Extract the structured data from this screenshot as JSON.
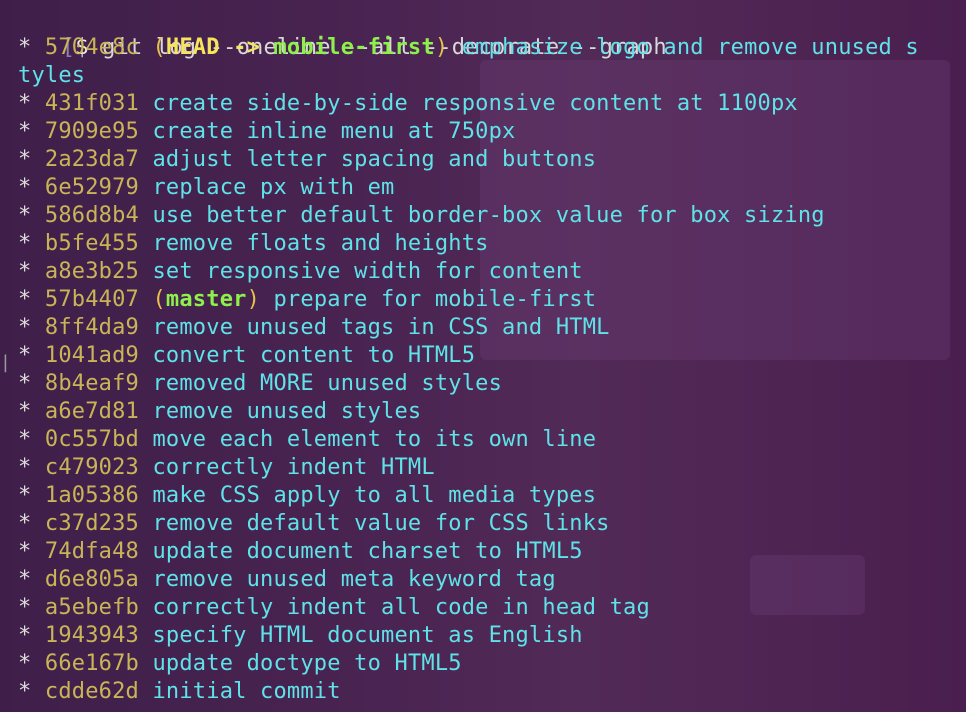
{
  "prompt": {
    "open_bracket": "[",
    "symbol": "$",
    "command": " git log --oneline --all --decorate --graph",
    "close_bracket": "]"
  },
  "commits": [
    {
      "graph": "* ",
      "hash": "5704e8c",
      "ref_open": "(",
      "head": "HEAD -> ",
      "branch": "mobile-first",
      "ref_close": ")",
      "message": "emphasize logo and remove unused s"
    },
    {
      "graph": "",
      "hash": "",
      "message": "tyles"
    },
    {
      "graph": "* ",
      "hash": "431f031",
      "message": "create side-by-side responsive content at 1100px"
    },
    {
      "graph": "* ",
      "hash": "7909e95",
      "message": "create inline menu at 750px"
    },
    {
      "graph": "* ",
      "hash": "2a23da7",
      "message": "adjust letter spacing and buttons"
    },
    {
      "graph": "* ",
      "hash": "6e52979",
      "message": "replace px with em"
    },
    {
      "graph": "* ",
      "hash": "586d8b4",
      "message": "use better default border-box value for box sizing"
    },
    {
      "graph": "* ",
      "hash": "b5fe455",
      "message": "remove floats and heights"
    },
    {
      "graph": "* ",
      "hash": "a8e3b25",
      "message": "set responsive width for content"
    },
    {
      "graph": "* ",
      "hash": "57b4407",
      "ref_open": "(",
      "branch": "master",
      "ref_close": ")",
      "message": "prepare for mobile-first"
    },
    {
      "graph": "* ",
      "hash": "8ff4da9",
      "message": "remove unused tags in CSS and HTML"
    },
    {
      "graph": "* ",
      "hash": "1041ad9",
      "message": "convert content to HTML5"
    },
    {
      "graph": "* ",
      "hash": "8b4eaf9",
      "message": "removed MORE unused styles"
    },
    {
      "graph": "* ",
      "hash": "a6e7d81",
      "message": "remove unused styles"
    },
    {
      "graph": "* ",
      "hash": "0c557bd",
      "message": "move each element to its own line"
    },
    {
      "graph": "* ",
      "hash": "c479023",
      "message": "correctly indent HTML"
    },
    {
      "graph": "* ",
      "hash": "1a05386",
      "message": "make CSS apply to all media types"
    },
    {
      "graph": "* ",
      "hash": "c37d235",
      "message": "remove default value for CSS links"
    },
    {
      "graph": "* ",
      "hash": "74dfa48",
      "message": "update document charset to HTML5"
    },
    {
      "graph": "* ",
      "hash": "d6e805a",
      "message": "remove unused meta keyword tag"
    },
    {
      "graph": "* ",
      "hash": "a5ebefb",
      "message": "correctly indent all code in head tag"
    },
    {
      "graph": "* ",
      "hash": "1943943",
      "message": "specify HTML document as English"
    },
    {
      "graph": "* ",
      "hash": "66e167b",
      "message": "update doctype to HTML5"
    },
    {
      "graph": "* ",
      "hash": "cdde62d",
      "message": "initial commit"
    }
  ],
  "colors": {
    "message": "#5fe2e8",
    "hash": "#c9b457",
    "head": "#f6e45c",
    "branch": "#8ef04a"
  }
}
